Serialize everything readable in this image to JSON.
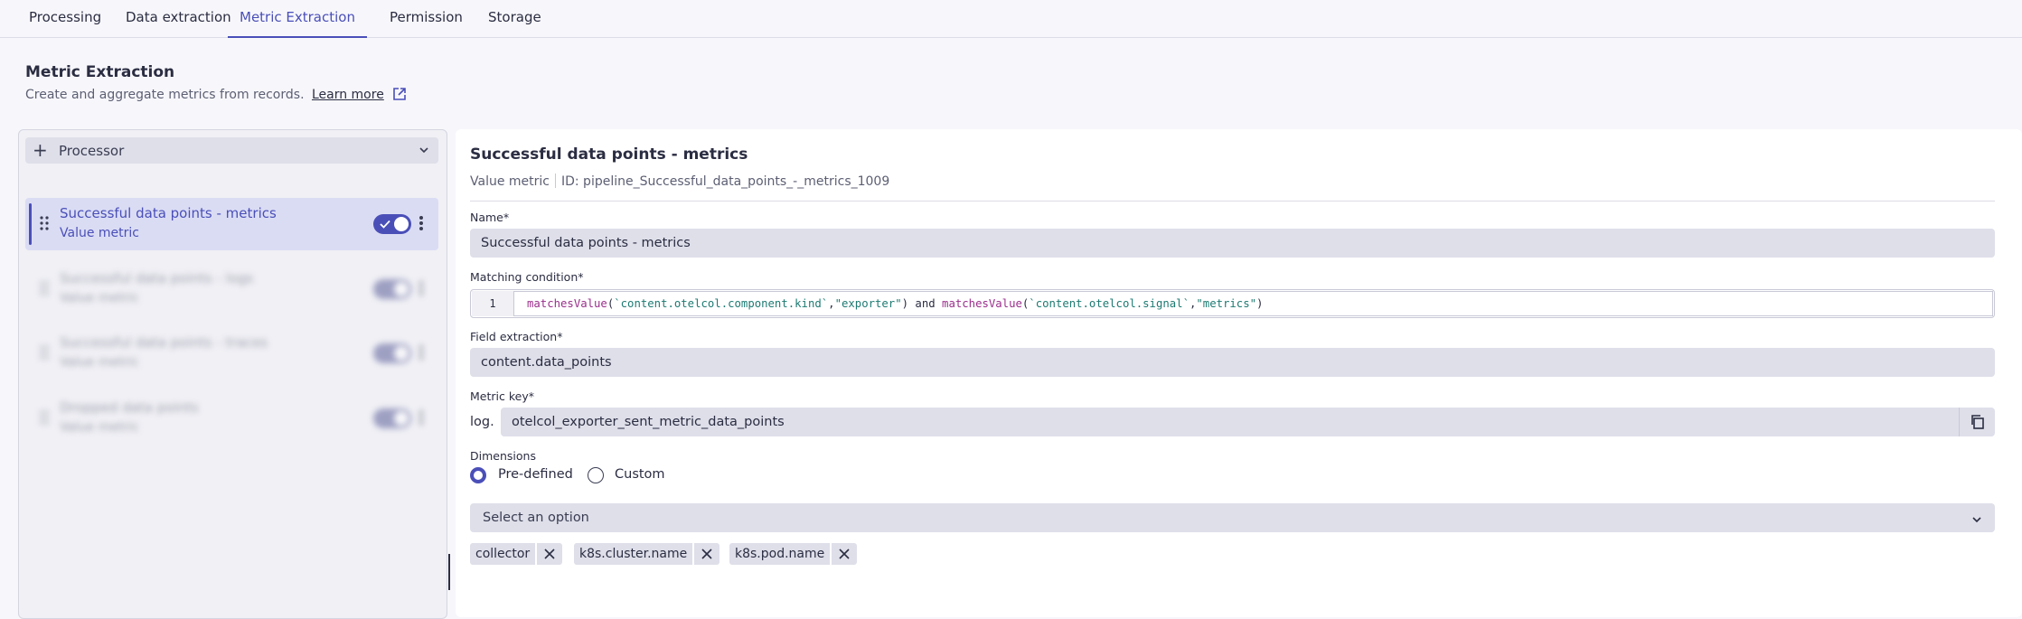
{
  "tabs": [
    "Processing",
    "Data extraction",
    "Metric Extraction",
    "Permission",
    "Storage"
  ],
  "active_tab": "Metric Extraction",
  "section": {
    "title": "Metric Extraction",
    "description": "Create and aggregate metrics from records.",
    "learn_more": "Learn more"
  },
  "sidebar": {
    "add_label": "Processor",
    "items": [
      {
        "title": "Successful data points - metrics",
        "subtitle": "Value metric",
        "enabled": true
      },
      {
        "title": "Successful data points - logs",
        "subtitle": "Value metric",
        "enabled": true
      },
      {
        "title": "Successful data points - traces",
        "subtitle": "Value metric",
        "enabled": true
      },
      {
        "title": "Dropped data points",
        "subtitle": "Value metric",
        "enabled": true
      }
    ]
  },
  "detail": {
    "title": "Successful data points - metrics",
    "type": "Value metric",
    "id": "ID: pipeline_Successful_data_points_-_metrics_1009",
    "name_label": "Name*",
    "name_value": "Successful data points - metrics",
    "matching_label": "Matching condition*",
    "code_line_no": "1",
    "code": {
      "fn1": "matchesValue",
      "open1": "(",
      "arg1": "`content.otelcol.component.kind`",
      "comma1": ",",
      "arg2": "\"exporter\"",
      "mid": ") and ",
      "fn2": "matchesValue",
      "open2": "(",
      "arg3": "`content.otelcol.signal`",
      "comma2": ",",
      "arg4": "\"metrics\"",
      "close": ")"
    },
    "field_label": "Field extraction*",
    "field_value": "content.data_points",
    "metric_key_label": "Metric key*",
    "metric_key_prefix": "log.",
    "metric_key_value": "otelcol_exporter_sent_metric_data_points",
    "dimensions_label": "Dimensions",
    "radio_predefined": "Pre-defined",
    "radio_custom": "Custom",
    "dimensions_mode": "Pre-defined",
    "select_placeholder": "Select an option",
    "chips": [
      "collector",
      "k8s.cluster.name",
      "k8s.pod.name"
    ]
  },
  "colors": {
    "accent": "#4a4fb8",
    "field_bg": "#dedfe9",
    "code_fn": "#9a2f8c",
    "code_str": "#1d7a72"
  },
  "icons": [
    "plus-icon",
    "chevron-down-icon",
    "drag-handle-icon",
    "check-icon",
    "more-vertical-icon",
    "external-link-icon",
    "copy-icon",
    "close-icon"
  ]
}
